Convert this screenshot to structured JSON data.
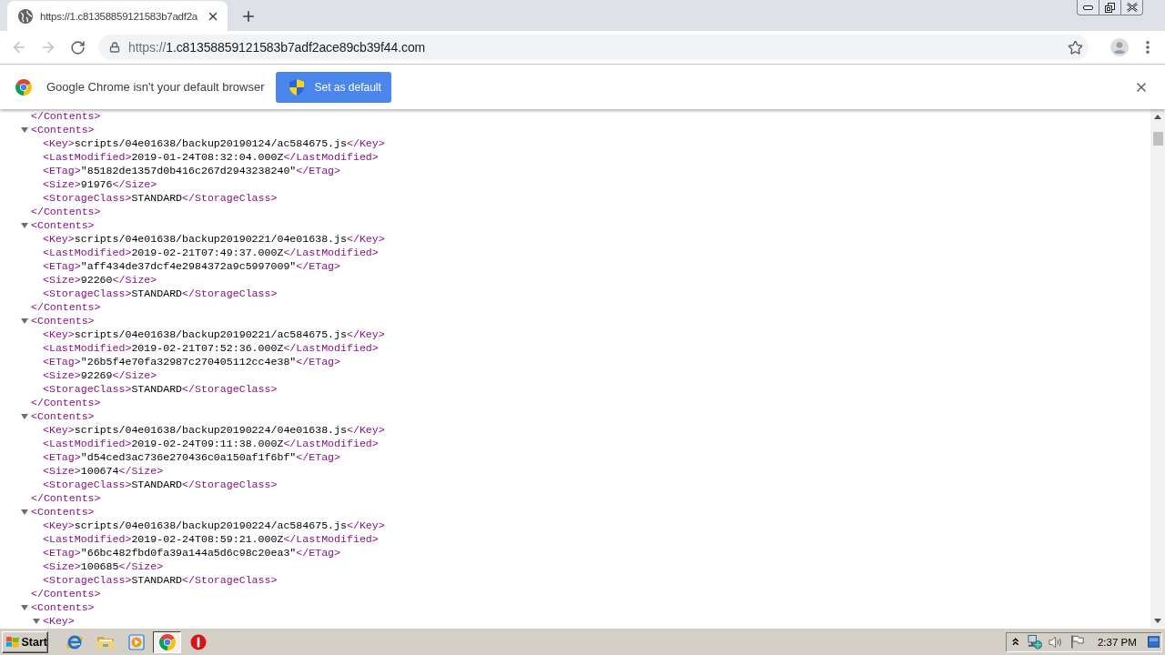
{
  "browser": {
    "tab": {
      "title": "https://1.c81358859121583b7adf2a",
      "selected": true
    },
    "nav": [
      {
        "kind": "back",
        "disabled": true
      },
      {
        "kind": "forward",
        "disabled": true
      },
      {
        "kind": "reload",
        "disabled": false
      }
    ],
    "address": {
      "scheme": "https://",
      "host": "1.c81358859121583b7adf2ace89cb39f44.com"
    }
  },
  "infobar": {
    "message": "Google Chrome isn't your default browser",
    "button": "Set as default"
  },
  "xml": [
    {
      "kind": "close",
      "close": "</Contents>"
    },
    {
      "kind": "element",
      "open": "<Contents>",
      "expanded": true,
      "close": "</Contents>",
      "children": [
        {
          "kind": "leaf",
          "open": "<Key>",
          "text": "scripts/04e01638/backup20190124/ac584675.js",
          "close": "</Key>"
        },
        {
          "kind": "leaf",
          "open": "<LastModified>",
          "text": "2019-01-24T08:32:04.000Z",
          "close": "</LastModified>"
        },
        {
          "kind": "leaf",
          "open": "<ETag>",
          "text": "\"85182de1357d0b416c267d2943238240\"",
          "close": "</ETag>"
        },
        {
          "kind": "leaf",
          "open": "<Size>",
          "text": "91976",
          "close": "</Size>"
        },
        {
          "kind": "leaf",
          "open": "<StorageClass>",
          "text": "STANDARD",
          "close": "</StorageClass>"
        }
      ]
    },
    {
      "kind": "element",
      "open": "<Contents>",
      "expanded": true,
      "close": "</Contents>",
      "children": [
        {
          "kind": "leaf",
          "open": "<Key>",
          "text": "scripts/04e01638/backup20190221/04e01638.js",
          "close": "</Key>"
        },
        {
          "kind": "leaf",
          "open": "<LastModified>",
          "text": "2019-02-21T07:49:37.000Z",
          "close": "</LastModified>"
        },
        {
          "kind": "leaf",
          "open": "<ETag>",
          "text": "\"aff434de37dcf4e2984372a9c5997009\"",
          "close": "</ETag>"
        },
        {
          "kind": "leaf",
          "open": "<Size>",
          "text": "92260",
          "close": "</Size>"
        },
        {
          "kind": "leaf",
          "open": "<StorageClass>",
          "text": "STANDARD",
          "close": "</StorageClass>"
        }
      ]
    },
    {
      "kind": "element",
      "open": "<Contents>",
      "expanded": true,
      "close": "</Contents>",
      "children": [
        {
          "kind": "leaf",
          "open": "<Key>",
          "text": "scripts/04e01638/backup20190221/ac584675.js",
          "close": "</Key>"
        },
        {
          "kind": "leaf",
          "open": "<LastModified>",
          "text": "2019-02-21T07:52:36.000Z",
          "close": "</LastModified>"
        },
        {
          "kind": "leaf",
          "open": "<ETag>",
          "text": "\"26b5f4e70fa32987c270405112cc4e38\"",
          "close": "</ETag>"
        },
        {
          "kind": "leaf",
          "open": "<Size>",
          "text": "92269",
          "close": "</Size>"
        },
        {
          "kind": "leaf",
          "open": "<StorageClass>",
          "text": "STANDARD",
          "close": "</StorageClass>"
        }
      ]
    },
    {
      "kind": "element",
      "open": "<Contents>",
      "expanded": true,
      "close": "</Contents>",
      "children": [
        {
          "kind": "leaf",
          "open": "<Key>",
          "text": "scripts/04e01638/backup20190224/04e01638.js",
          "close": "</Key>"
        },
        {
          "kind": "leaf",
          "open": "<LastModified>",
          "text": "2019-02-24T09:11:38.000Z",
          "close": "</LastModified>"
        },
        {
          "kind": "leaf",
          "open": "<ETag>",
          "text": "\"d54ced3ac736e270436c0a150af1f6bf\"",
          "close": "</ETag>"
        },
        {
          "kind": "leaf",
          "open": "<Size>",
          "text": "100674",
          "close": "</Size>"
        },
        {
          "kind": "leaf",
          "open": "<StorageClass>",
          "text": "STANDARD",
          "close": "</StorageClass>"
        }
      ]
    },
    {
      "kind": "element",
      "open": "<Contents>",
      "expanded": true,
      "close": "</Contents>",
      "children": [
        {
          "kind": "leaf",
          "open": "<Key>",
          "text": "scripts/04e01638/backup20190224/ac584675.js",
          "close": "</Key>"
        },
        {
          "kind": "leaf",
          "open": "<LastModified>",
          "text": "2019-02-24T08:59:21.000Z",
          "close": "</LastModified>"
        },
        {
          "kind": "leaf",
          "open": "<ETag>",
          "text": "\"66bc482fbd0fa39a144a5d6c98c20ea3\"",
          "close": "</ETag>"
        },
        {
          "kind": "leaf",
          "open": "<Size>",
          "text": "100685",
          "close": "</Size>"
        },
        {
          "kind": "leaf",
          "open": "<StorageClass>",
          "text": "STANDARD",
          "close": "</StorageClass>"
        }
      ]
    },
    {
      "kind": "element",
      "open": "<Contents>",
      "expanded": true,
      "children": [
        {
          "kind": "element",
          "open": "<Key>",
          "expanded": true
        }
      ]
    }
  ],
  "taskbar": {
    "start": "Start",
    "apps": [
      {
        "kind": "ie",
        "selected": false
      },
      {
        "kind": "folder",
        "selected": false
      },
      {
        "kind": "media",
        "selected": false
      },
      {
        "kind": "chrome",
        "selected": true
      },
      {
        "kind": "alert",
        "selected": false
      }
    ],
    "clock": "2:37 PM"
  }
}
